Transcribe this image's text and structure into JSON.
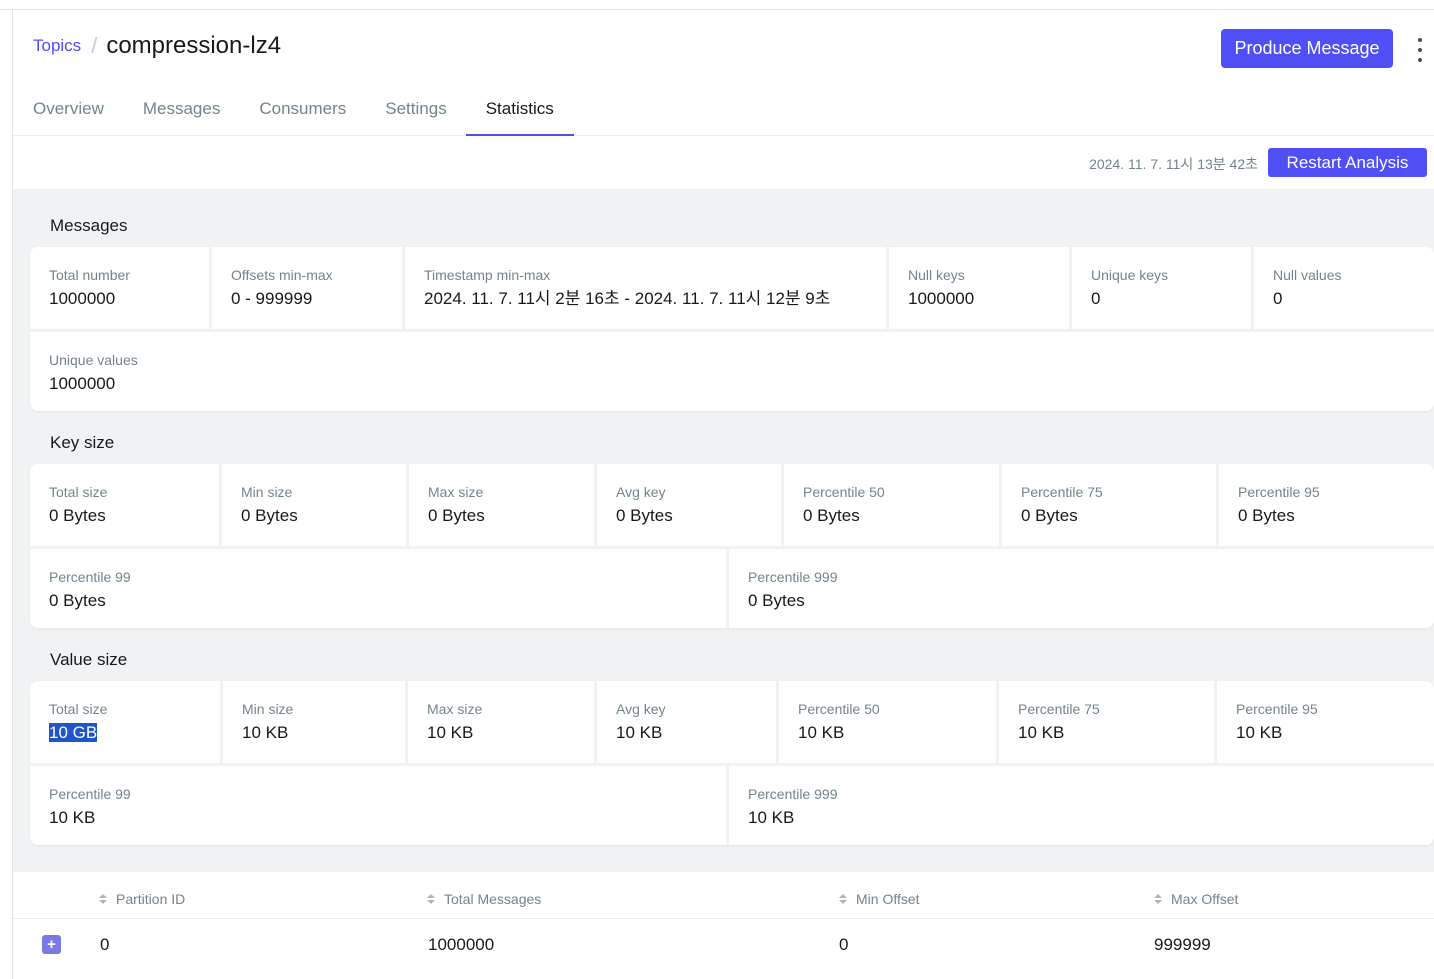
{
  "breadcrumb": {
    "parent": "Topics",
    "separator": "/",
    "title": "compression-lz4"
  },
  "actions": {
    "produce_label": "Produce Message",
    "menu_icon": "kebab-icon"
  },
  "tabs": [
    {
      "label": "Overview",
      "active": false
    },
    {
      "label": "Messages",
      "active": false
    },
    {
      "label": "Consumers",
      "active": false
    },
    {
      "label": "Settings",
      "active": false
    },
    {
      "label": "Statistics",
      "active": true
    }
  ],
  "analysis": {
    "timestamp": "2024. 11. 7. 11시 13분 42초",
    "restart_label": "Restart Analysis"
  },
  "messages": {
    "title": "Messages",
    "total_number": {
      "label": "Total number",
      "value": "1000000"
    },
    "offsets": {
      "label": "Offsets min-max",
      "value": "0 - 999999"
    },
    "timestamp_range": {
      "label": "Timestamp min-max",
      "value": "2024. 11. 7. 11시 2분 16초 - 2024. 11. 7. 11시 12분 9초"
    },
    "null_keys": {
      "label": "Null keys",
      "value": "1000000"
    },
    "unique_keys": {
      "label": "Unique keys",
      "value": "0"
    },
    "null_values": {
      "label": "Null values",
      "value": "0"
    },
    "unique_values": {
      "label": "Unique values",
      "value": "1000000"
    }
  },
  "key_size": {
    "title": "Key size",
    "total": {
      "label": "Total size",
      "value": "0 Bytes"
    },
    "min": {
      "label": "Min size",
      "value": "0 Bytes"
    },
    "max": {
      "label": "Max size",
      "value": "0 Bytes"
    },
    "avg": {
      "label": "Avg key",
      "value": "0 Bytes"
    },
    "p50": {
      "label": "Percentile 50",
      "value": "0 Bytes"
    },
    "p75": {
      "label": "Percentile 75",
      "value": "0 Bytes"
    },
    "p95": {
      "label": "Percentile 95",
      "value": "0 Bytes"
    },
    "p99": {
      "label": "Percentile 99",
      "value": "0 Bytes"
    },
    "p999": {
      "label": "Percentile 999",
      "value": "0 Bytes"
    }
  },
  "value_size": {
    "title": "Value size",
    "total": {
      "label": "Total size",
      "value": "10 GB"
    },
    "min": {
      "label": "Min size",
      "value": "10 KB"
    },
    "max": {
      "label": "Max size",
      "value": "10 KB"
    },
    "avg": {
      "label": "Avg key",
      "value": "10 KB"
    },
    "p50": {
      "label": "Percentile 50",
      "value": "10 KB"
    },
    "p75": {
      "label": "Percentile 75",
      "value": "10 KB"
    },
    "p95": {
      "label": "Percentile 95",
      "value": "10 KB"
    },
    "p99": {
      "label": "Percentile 99",
      "value": "10 KB"
    },
    "p999": {
      "label": "Percentile 999",
      "value": "10 KB"
    }
  },
  "partition_table": {
    "headers": [
      "Partition ID",
      "Total Messages",
      "Min Offset",
      "Max Offset"
    ],
    "rows": [
      {
        "expand": "+",
        "partition_id": "0",
        "total_messages": "1000000",
        "min_offset": "0",
        "max_offset": "999999"
      }
    ]
  }
}
